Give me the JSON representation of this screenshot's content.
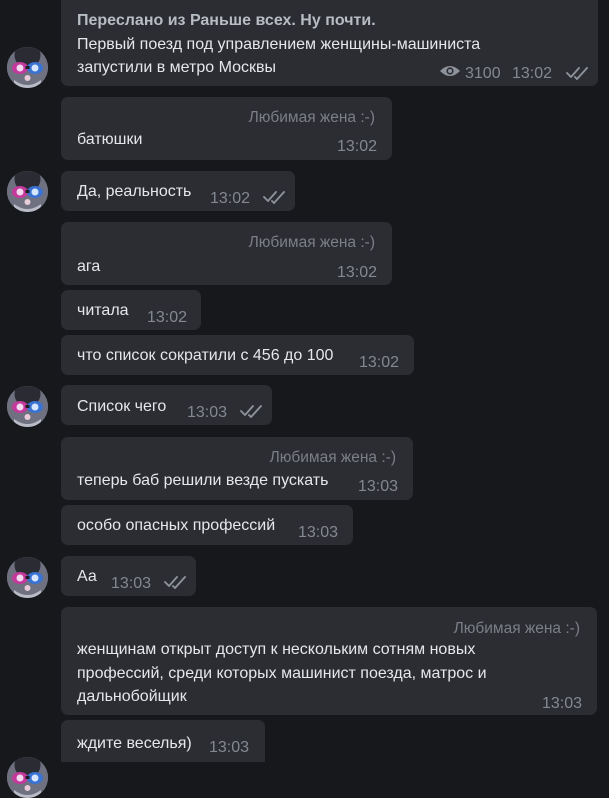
{
  "chat": {
    "forwarded_post": {
      "header": "Переслано из Раньше всех. Ну почти.",
      "line1": "Первый поезд под управлением женщины-машиниста",
      "line2": "запустили в метро Москвы",
      "views": "3100",
      "time": "13:02",
      "read_icon": "double-check-icon",
      "views_icon": "eye-icon"
    },
    "messages": [
      {
        "sender": "Любимая жена :-)",
        "text": "батюшки",
        "time": "13:02"
      },
      {
        "text": "Да, реальность",
        "time": "13:02",
        "read": true
      },
      {
        "sender": "Любимая жена :-)",
        "text": "ага",
        "time": "13:02"
      },
      {
        "text": "читала",
        "time": "13:02"
      },
      {
        "text": "что список сократили с 456 до 100",
        "time": "13:02"
      },
      {
        "text": "Список чего",
        "time": "13:03",
        "read": true
      },
      {
        "sender": "Любимая жена :-)",
        "text": "теперь баб решили везде пускать",
        "time": "13:03"
      },
      {
        "text": "особо опасных профессий",
        "time": "13:03"
      },
      {
        "text": "Аа",
        "time": "13:03",
        "read": true
      },
      {
        "sender": "Любимая жена :-)",
        "line1": "женщинам открыт доступ к нескольким сотням новых",
        "line2": "профессий, среди которых машинист поезда, матрос и",
        "line3": "дальнобойщик",
        "time": "13:03"
      },
      {
        "text": "ждите веселья)",
        "time": "13:03"
      }
    ]
  },
  "colors": {
    "background": "#17181c",
    "bubble": "#2c2d33",
    "text": "#e6e7ea",
    "meta": "#838891"
  }
}
